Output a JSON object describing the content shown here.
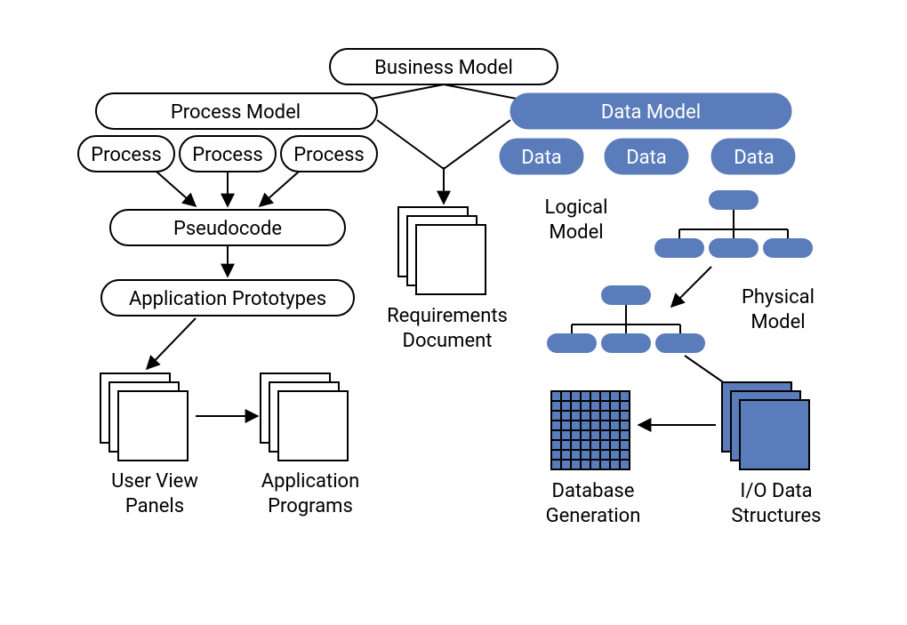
{
  "top": {
    "business_model": "Business Model"
  },
  "left": {
    "process_model": "Process Model",
    "process1": "Process",
    "process2": "Process",
    "process3": "Process",
    "pseudocode": "Pseudocode",
    "application_prototypes": "Application Prototypes",
    "user_view_panels_l1": "User View",
    "user_view_panels_l2": "Panels",
    "application_programs_l1": "Application",
    "application_programs_l2": "Programs"
  },
  "center": {
    "requirements_document_l1": "Requirements",
    "requirements_document_l2": "Document"
  },
  "right": {
    "data_model": "Data Model",
    "data1": "Data",
    "data2": "Data",
    "data3": "Data",
    "logical_model_l1": "Logical",
    "logical_model_l2": "Model",
    "physical_model_l1": "Physical",
    "physical_model_l2": "Model",
    "database_generation_l1": "Database",
    "database_generation_l2": "Generation",
    "io_data_structures_l1": "I/O Data",
    "io_data_structures_l2": "Structures"
  }
}
